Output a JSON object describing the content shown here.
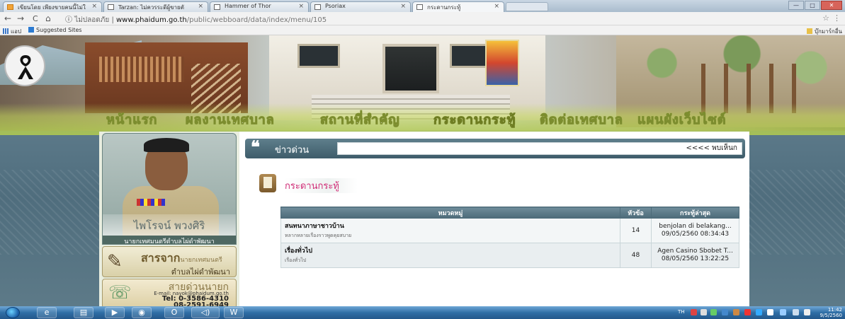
{
  "browser": {
    "tabs": [
      {
        "label": "เขียนโดย เพียงขายคนนี้ไม่ใ",
        "active": false
      },
      {
        "label": "Tarzan: ไม่ควรระดีผู้ขายตั",
        "active": false
      },
      {
        "label": "Hammer of Thor",
        "active": false
      },
      {
        "label": "Psoriax",
        "active": false
      },
      {
        "label": "กระดานกระทู้",
        "active": true
      }
    ],
    "tab_close": "×",
    "window_buttons": {
      "minimize": "—",
      "maximize": "□",
      "close": "✕"
    },
    "nav": {
      "back": "←",
      "forward": "→",
      "reload": "C",
      "home": "⌂"
    },
    "address": {
      "security_label": "ไม่ปลอดภัย",
      "domain": "www.phaidum.go.th",
      "path": "/public/webboard/data/index/menu/105"
    },
    "star": "☆",
    "menu": "⋮",
    "bookmarks": {
      "apps": "แอป",
      "suggested": "Suggested Sites",
      "other": "บุ๊กมาร์กอื่น"
    }
  },
  "site": {
    "menu": [
      "หน้าแรก",
      "ผลงานเทศบาล",
      "สถานที่สำคัญ",
      "กระดานกระทู้",
      "ติดต่อเทศบาล",
      "แผนผังเว็บไซต์"
    ],
    "mayor": {
      "name": "ไพโรจน์ พวงศิริ",
      "title": "นายกเทศมนตรีตำบลไผ่ดำพัฒนา"
    },
    "message": {
      "title": "สารจาก",
      "title_small": "นายกเทศมนตรี",
      "subtitle": "ตำบลไผ่ดำพัฒนา"
    },
    "hotline": {
      "title": "สายด่วนนายก",
      "email": "E-mail: nayok@phaidum.go.th",
      "tel": "Tel: 0-3586-4310",
      "mobile": "08-2591-6949"
    },
    "news": {
      "quote_mark": "❝",
      "label": "ข่าวด่วน",
      "ticker": "<<<< พบเห็นก"
    },
    "board": {
      "title": "กระดานกระทู้",
      "columns": [
        "หมวดหมู่",
        "หัวข้อ",
        "กระทู้ล่าสุด"
      ],
      "rows": [
        {
          "title": "สนทนาภาษาชาวบ้าน",
          "desc": "หลากหลายเรื่องราวพูดคุยสบาย",
          "count": "14",
          "latest_title": "benjolan di belakang...",
          "latest_time": "09/05/2560 08:34:43"
        },
        {
          "title": "เรื่องทั่วไป",
          "desc": "เรื่องทั่วไป",
          "count": "48",
          "latest_title": "Agen Casino Sbobet T...",
          "latest_time": "08/05/2560 13:22:25"
        }
      ]
    }
  },
  "taskbar": {
    "lang": "TH",
    "time": "11:42",
    "date": "9/5/2560"
  },
  "colors": {
    "accent_pink": "#d02d77",
    "header_blue": "#4d6b79",
    "menu_green": "#c6da5a"
  }
}
